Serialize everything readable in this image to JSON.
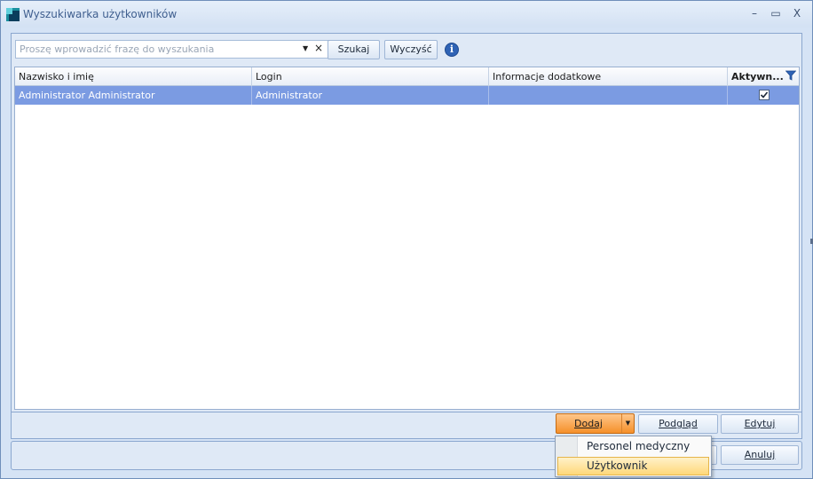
{
  "window": {
    "title": "Wyszukiwarka użytkowników",
    "controls": {
      "minimize": "–",
      "maximize": "▭",
      "close": "X"
    }
  },
  "search": {
    "placeholder": "Proszę wprowadzić frazę do wyszukania",
    "value": "",
    "dropdown_glyph": "▼",
    "clear_glyph": "×",
    "search_button": "Szukaj",
    "clear_button": "Wyczyść",
    "info_glyph": "i"
  },
  "table": {
    "columns": [
      "Nazwisko i imię",
      "Login",
      "Informacje dodatkowe",
      "Aktywn..."
    ],
    "rows": [
      {
        "name": "Administrator Administrator",
        "login": "Administrator",
        "info": "",
        "active": true
      }
    ]
  },
  "toolbar": {
    "add_button": "Dodaj",
    "add_arrow": "▼",
    "preview_button": "Podgląd",
    "edit_button": "Edytuj"
  },
  "add_menu": {
    "items": [
      "Personel medyczny",
      "Użytkownik"
    ],
    "highlighted": "Użytkownik"
  },
  "bottom": {
    "cancel_button": "Anuluj"
  },
  "colors": {
    "selected_row": "#7b9be2",
    "add_button": "#f5902a",
    "title_text": "#3f5f8f"
  },
  "icons": [
    "app-icon",
    "info-icon",
    "filter-icon",
    "checkbox-checked-icon"
  ]
}
